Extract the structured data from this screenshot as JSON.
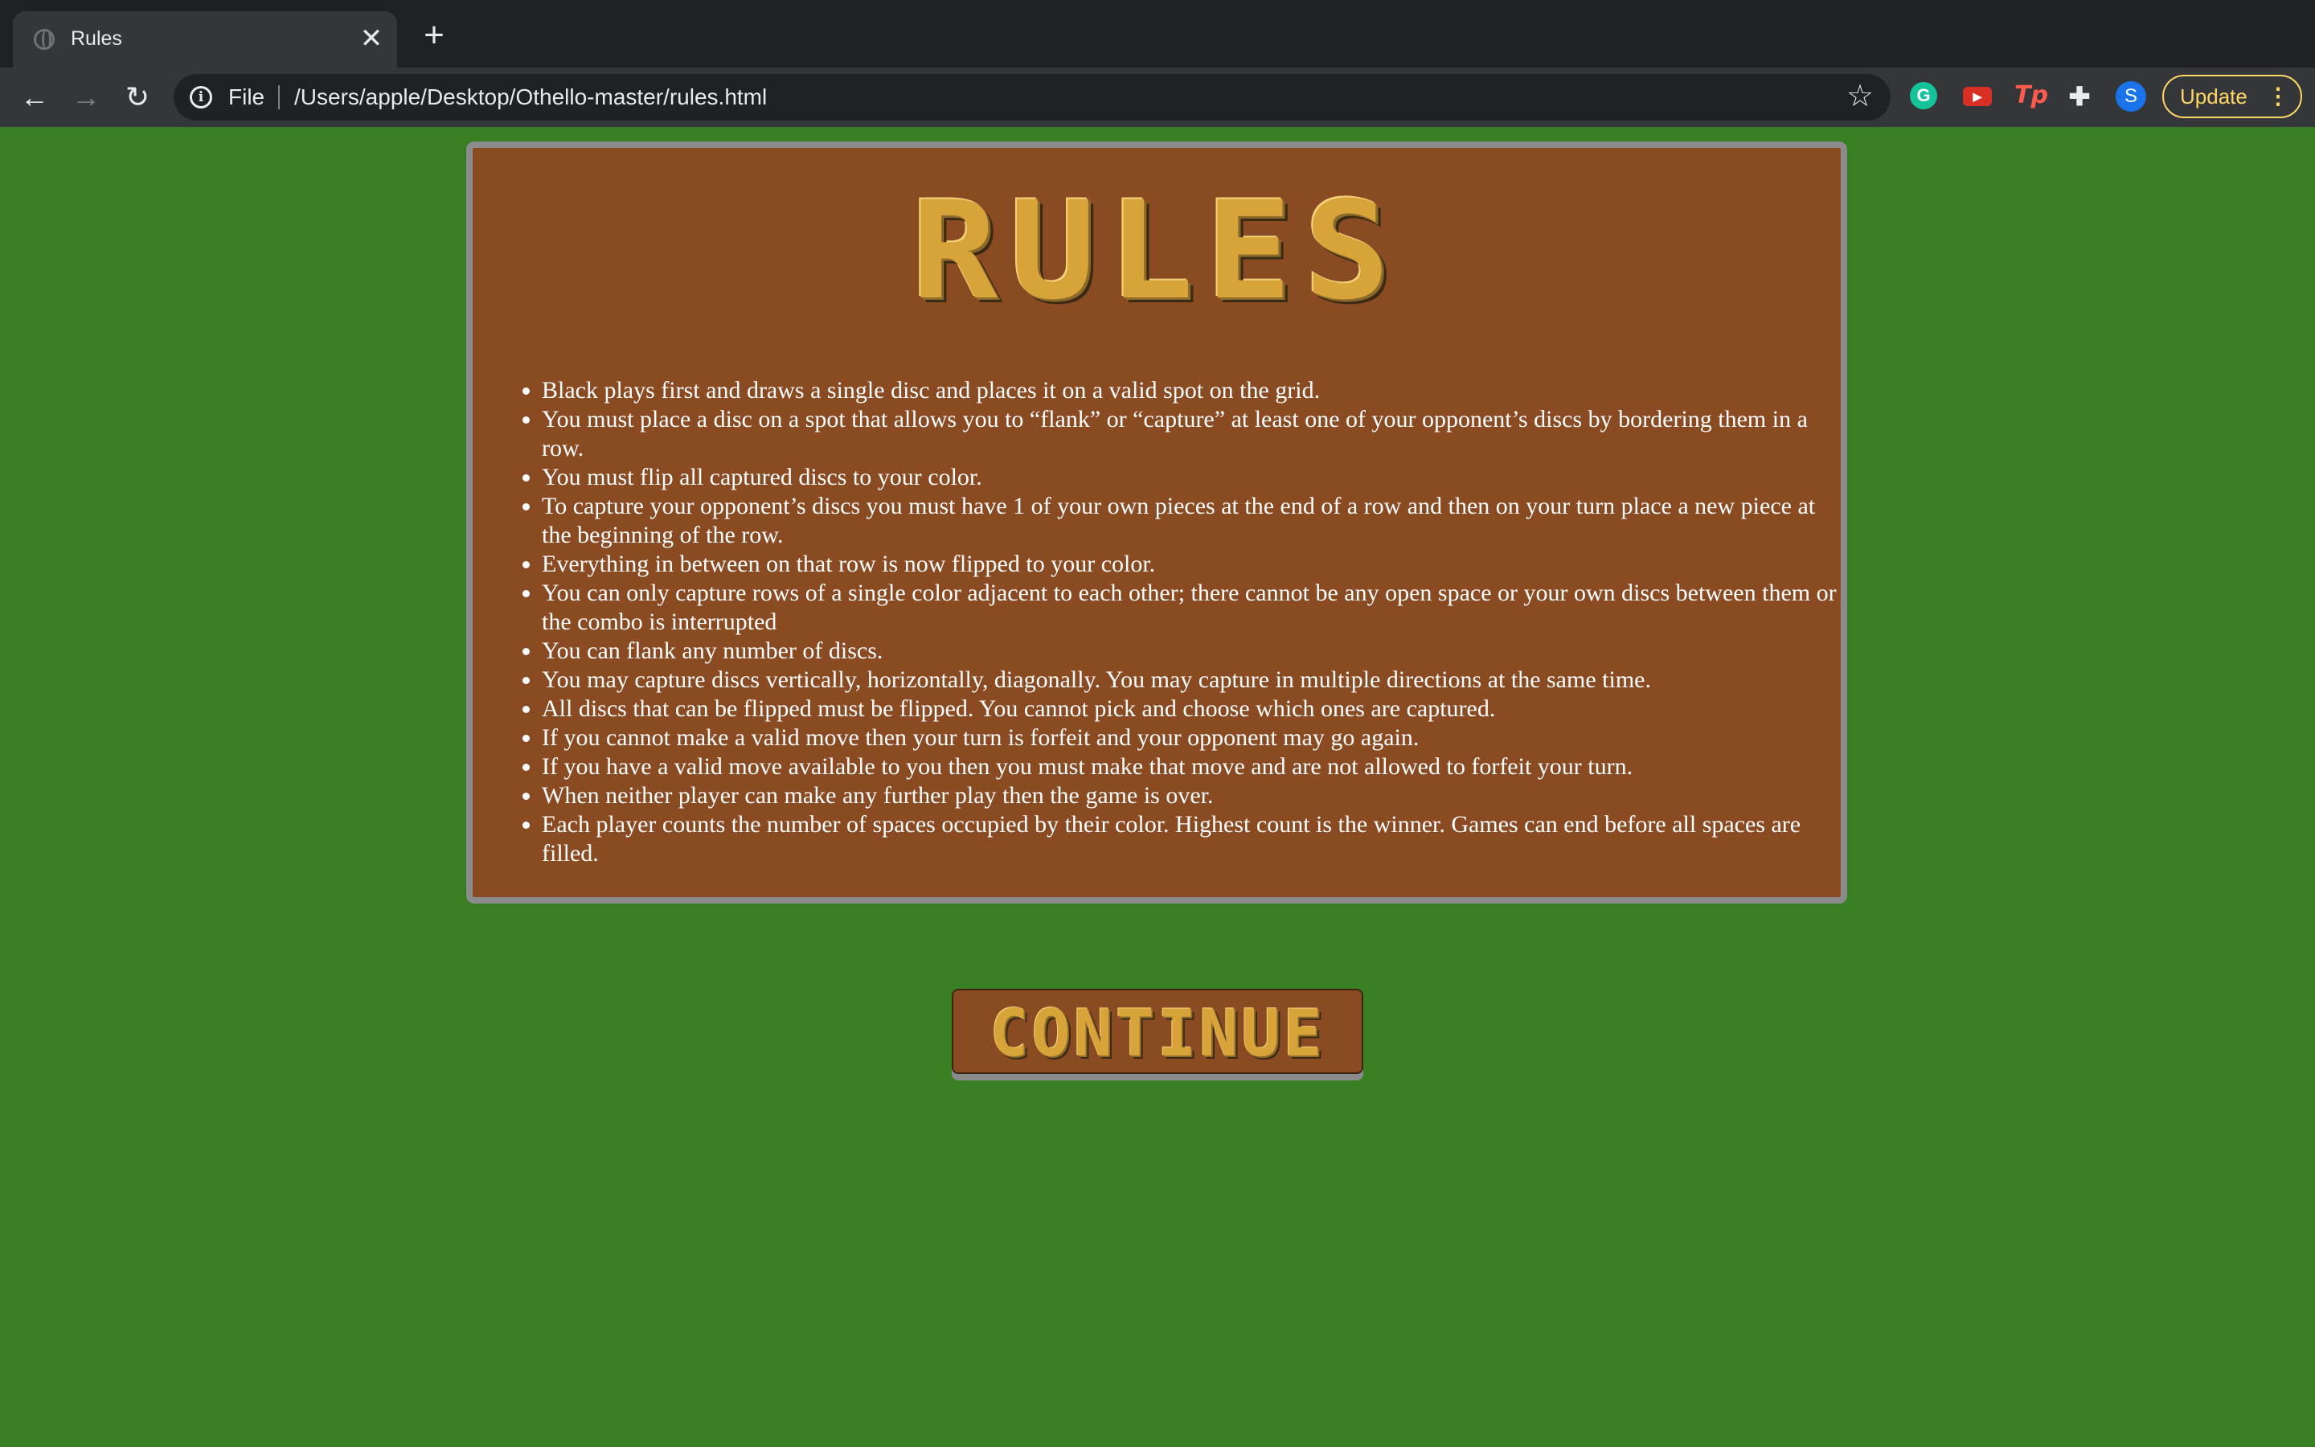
{
  "browser": {
    "tab": {
      "title": "Rules",
      "close_glyph": "✕",
      "favicon": "globe-icon"
    },
    "new_tab_glyph": "+",
    "nav": {
      "back_glyph": "←",
      "forward_glyph": "→",
      "reload_glyph": "↻"
    },
    "address": {
      "info_glyph": "i",
      "scheme": "File",
      "url": "/Users/apple/Desktop/Othello-master/rules.html",
      "star_glyph": "☆"
    },
    "extensions": [
      {
        "name": "grammarly-icon",
        "glyph": "G"
      },
      {
        "name": "youtube-icon",
        "glyph": "▶"
      },
      {
        "name": "tp-extension-icon",
        "glyph": "Tp"
      },
      {
        "name": "puzzle-icon",
        "glyph": "✚"
      }
    ],
    "profile_initial": "S",
    "update_label": "Update",
    "menu_glyph": "⋮"
  },
  "page": {
    "title": "RULES",
    "rules": [
      "Black plays first and draws a single disc and places it on a valid spot on the grid.",
      "You must place a disc on a spot that allows you to “flank” or “capture” at least one of your opponent’s discs by bordering them in a row.",
      "You must flip all captured discs to your color.",
      "To capture your opponent’s discs you must have 1 of your own pieces at the end of a row and then on your turn place a new piece at the beginning of the row.",
      "Everything in between on that row is now flipped to your color.",
      "You can only capture rows of a single color adjacent to each other; there cannot be any open space or your own discs between them or the combo is interrupted",
      "You can flank any number of discs.",
      "You may capture discs vertically, horizontally, diagonally. You may capture in multiple directions at the same time.",
      "All discs that can be flipped must be flipped. You cannot pick and choose which ones are captured.",
      "If you cannot make a valid move then your turn is forfeit and your opponent may go again.",
      "If you have a valid move available to you then you must make that move and are not allowed to forfeit your turn.",
      "When neither player can make any further play then the game is over.",
      "Each player counts the number of spaces occupied by their color. Highest count is the winner. Games can end before all spaces are filled."
    ],
    "continue_label": "CONTINUE"
  },
  "colors": {
    "page_background": "#377f22",
    "panel_background": "#8a4b23",
    "panel_border": "#8b8b8b",
    "title_gold": "#d8a43a",
    "rule_text": "#ffffff"
  }
}
